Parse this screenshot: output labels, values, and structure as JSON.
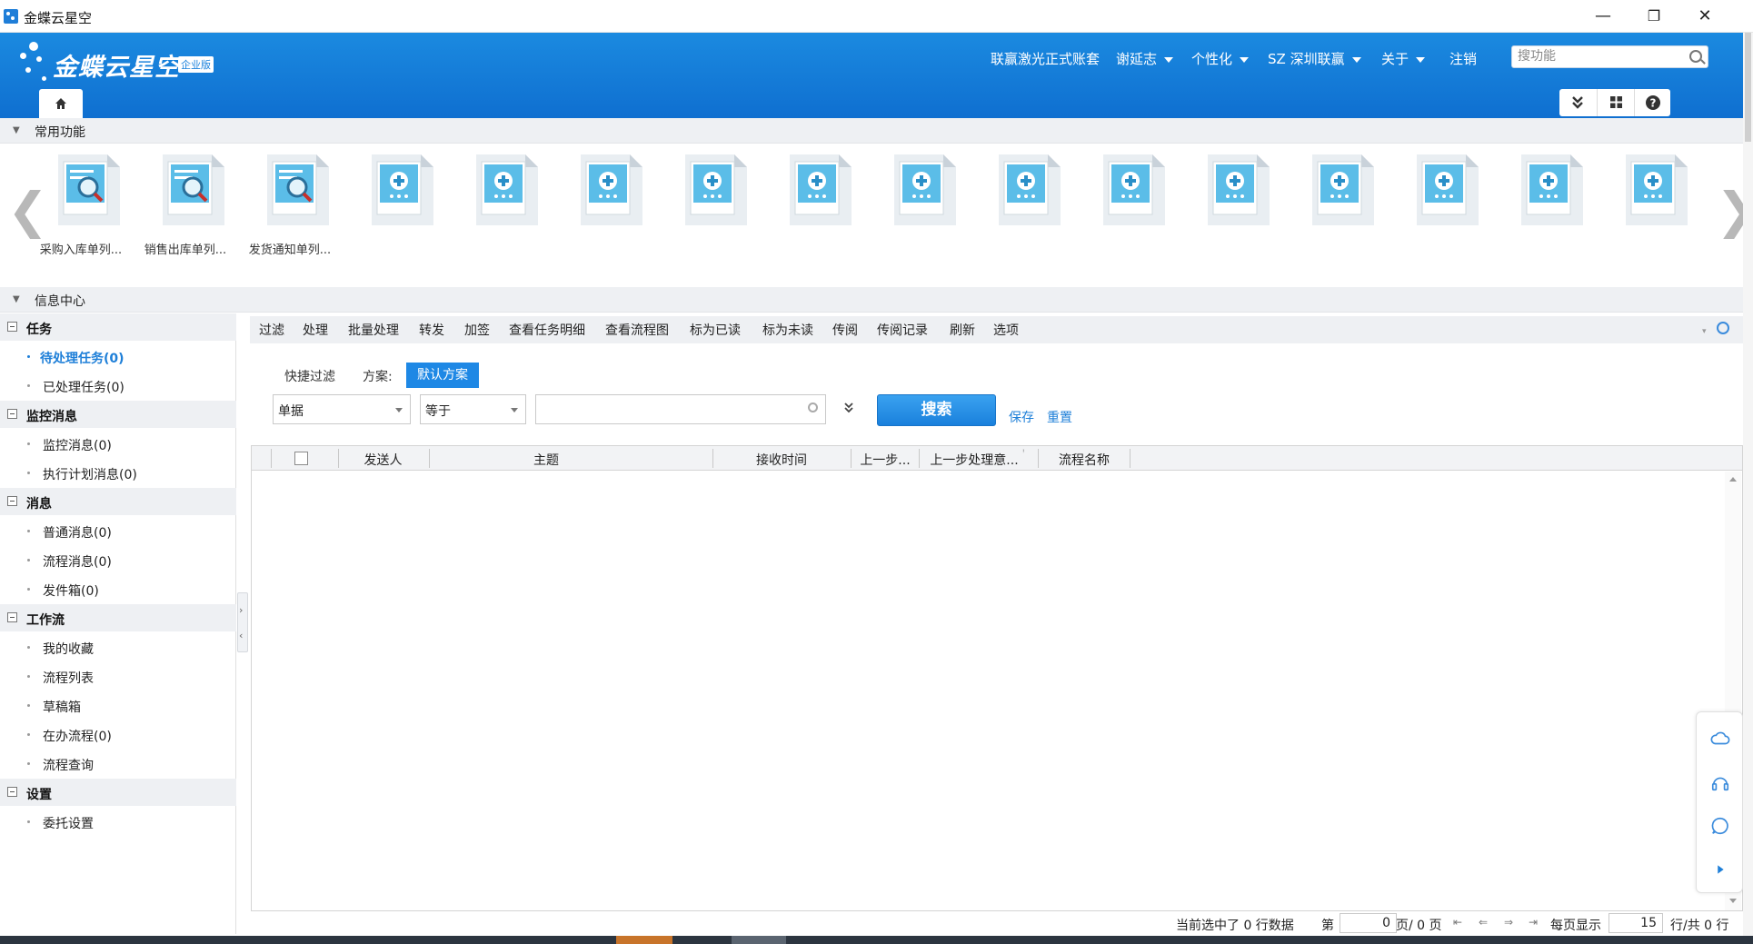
{
  "window": {
    "title": "金蝶云星空",
    "min": "—",
    "max": "❐",
    "close": "✕"
  },
  "header": {
    "logo_text": "金蝶云星空",
    "logo_badge": "企业版",
    "nav": [
      {
        "label": "联赢激光正式账套",
        "dropdown": false
      },
      {
        "label": "谢延志",
        "dropdown": true
      },
      {
        "label": "个性化",
        "dropdown": true
      },
      {
        "label": "SZ  深圳联赢",
        "dropdown": true
      },
      {
        "label": "关于",
        "dropdown": true
      },
      {
        "label": "注销",
        "dropdown": false
      }
    ],
    "search_placeholder": "搜功能",
    "colors": {
      "header_blue": "#1379d6",
      "accent": "#1e88e5"
    }
  },
  "common_functions": {
    "title": "常用功能",
    "items": [
      {
        "label": "采购入库单列...",
        "icon": "doc-search-icon"
      },
      {
        "label": "销售出库单列...",
        "icon": "doc-search-icon"
      },
      {
        "label": "发货通知单列...",
        "icon": "doc-search-icon"
      },
      {
        "label": "",
        "icon": "doc-add-icon"
      },
      {
        "label": "",
        "icon": "doc-add-icon"
      },
      {
        "label": "",
        "icon": "doc-add-icon"
      },
      {
        "label": "",
        "icon": "doc-add-icon"
      },
      {
        "label": "",
        "icon": "doc-add-icon"
      },
      {
        "label": "",
        "icon": "doc-add-icon"
      },
      {
        "label": "",
        "icon": "doc-add-icon"
      },
      {
        "label": "",
        "icon": "doc-add-icon"
      },
      {
        "label": "",
        "icon": "doc-add-icon"
      },
      {
        "label": "",
        "icon": "doc-add-icon"
      },
      {
        "label": "",
        "icon": "doc-add-icon"
      },
      {
        "label": "",
        "icon": "doc-add-icon"
      },
      {
        "label": "",
        "icon": "doc-add-icon"
      }
    ],
    "prev": "❮",
    "next": "❯"
  },
  "info_center": {
    "title": "信息中心",
    "groups": [
      {
        "label": "任务",
        "items": [
          {
            "label": "待处理任务(0)",
            "active": true
          },
          {
            "label": "已处理任务(0)",
            "active": false
          }
        ]
      },
      {
        "label": "监控消息",
        "items": [
          {
            "label": "监控消息(0)",
            "active": false
          },
          {
            "label": "执行计划消息(0)",
            "active": false
          }
        ]
      },
      {
        "label": "消息",
        "items": [
          {
            "label": "普通消息(0)",
            "active": false
          },
          {
            "label": "流程消息(0)",
            "active": false
          },
          {
            "label": "发件箱(0)",
            "active": false
          }
        ]
      },
      {
        "label": "工作流",
        "items": [
          {
            "label": "我的收藏",
            "active": false
          },
          {
            "label": "流程列表",
            "active": false
          },
          {
            "label": "草稿箱",
            "active": false
          },
          {
            "label": "在办流程(0)",
            "active": false
          },
          {
            "label": "流程查询",
            "active": false
          }
        ]
      },
      {
        "label": "设置",
        "items": [
          {
            "label": "委托设置",
            "active": false
          }
        ]
      }
    ]
  },
  "toolbar": {
    "items": [
      "过滤",
      "处理",
      "批量处理",
      "转发",
      "加签",
      "查看任务明细",
      "查看流程图",
      "标为已读",
      "标为未读",
      "传阅",
      "传阅记录",
      "刷新",
      "选项"
    ]
  },
  "filter": {
    "quick_filter": "快捷过滤",
    "scheme_label": "方案:",
    "scheme_value": "默认方案",
    "field": "单据",
    "operator": "等于",
    "value": "",
    "search_label": "搜索",
    "save_label": "保存",
    "reset_label": "重置"
  },
  "grid": {
    "columns": [
      "发送人",
      "主题",
      "接收时间",
      "上一步...",
      "上一步处理意...",
      "流程名称"
    ]
  },
  "pager": {
    "selected_text": "当前选中了 0 行数据",
    "page_prefix": "第",
    "page_value": "0",
    "page_suffix": "页/ 0 页",
    "per_page_label": "每页显示",
    "per_page_value": "15",
    "total_text": "行/共 0 行"
  }
}
